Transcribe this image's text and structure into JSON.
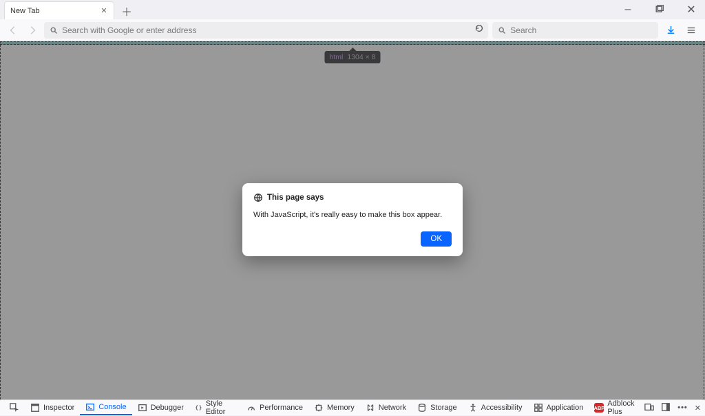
{
  "window": {
    "controls": {
      "min": "–",
      "max": "▢",
      "close": "✕"
    }
  },
  "tab": {
    "title": "New Tab"
  },
  "toolbar": {
    "url_placeholder": "Search with Google or enter address",
    "search_placeholder": "Search"
  },
  "inspect_tooltip": {
    "tag": "html",
    "dimensions": "1304 × 8"
  },
  "dialog": {
    "title": "This page says",
    "message": "With JavaScript, it's really easy to make this box appear.",
    "ok": "OK"
  },
  "devtools": {
    "panels": [
      {
        "id": "inspector",
        "label": "Inspector"
      },
      {
        "id": "console",
        "label": "Console"
      },
      {
        "id": "debugger",
        "label": "Debugger"
      },
      {
        "id": "style-editor",
        "label": "Style Editor"
      },
      {
        "id": "performance",
        "label": "Performance"
      },
      {
        "id": "memory",
        "label": "Memory"
      },
      {
        "id": "network",
        "label": "Network"
      },
      {
        "id": "storage",
        "label": "Storage"
      },
      {
        "id": "accessibility",
        "label": "Accessibility"
      },
      {
        "id": "application",
        "label": "Application"
      },
      {
        "id": "adblock-plus",
        "label": "Adblock Plus"
      }
    ],
    "active_panel": "console"
  }
}
